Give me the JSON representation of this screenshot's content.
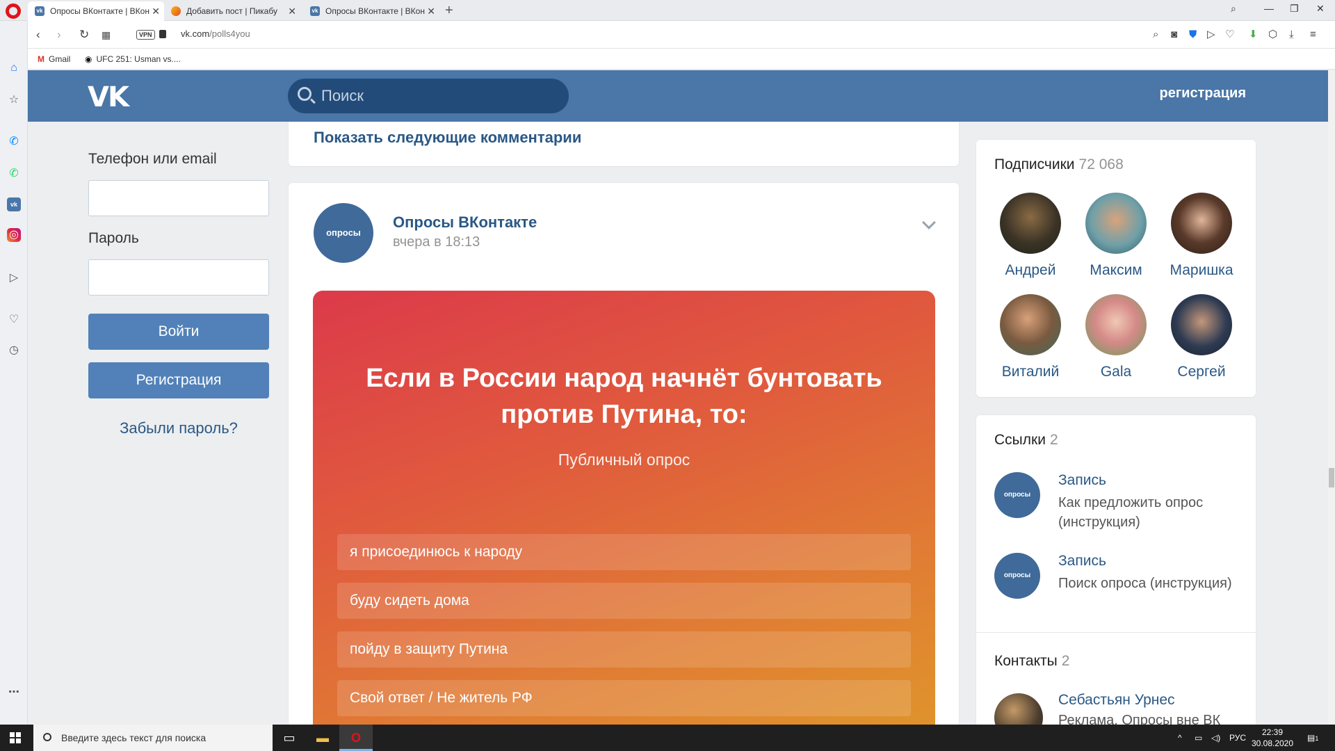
{
  "browser": {
    "tabs": [
      {
        "title": "Опросы ВКонтакте | ВКон",
        "favicon": "vk"
      },
      {
        "title": "Добавить пост | Пикабу",
        "favicon": "pikabu"
      },
      {
        "title": "Опросы ВКонтакте | ВКон",
        "favicon": "vk"
      }
    ],
    "vpn_label": "VPN",
    "url_domain": "vk.com",
    "url_path": "/polls4you",
    "bookmarks": [
      {
        "label": "Gmail",
        "icon": "M"
      },
      {
        "label": "UFC 251: Usman vs....",
        "icon": "ufc"
      }
    ]
  },
  "header": {
    "logo": "VK",
    "search_placeholder": "Поиск",
    "register_link": "регистрация"
  },
  "login": {
    "phone_label": "Телефон или email",
    "password_label": "Пароль",
    "login_button": "Войти",
    "register_button": "Регистрация",
    "forgot_link": "Забыли пароль?"
  },
  "feed": {
    "show_more": "Показать следующие комментарии",
    "post": {
      "author": "Опросы ВКонтакте",
      "time": "вчера в 18:13",
      "avatar_text": "опросы",
      "poll": {
        "question": "Если в России народ начнёт бунтовать против Путина, то:",
        "type": "Публичный опрос",
        "options": [
          "я присоединюсь к народу",
          "буду сидеть дома",
          "пойду в защиту Путина",
          "Свой ответ / Не житель РФ"
        ]
      }
    }
  },
  "sidebar": {
    "subscribers": {
      "title": "Подписчики",
      "count": "72 068",
      "members": [
        "Андрей",
        "Максим",
        "Маришка",
        "Виталий",
        "Gala",
        "Сергей"
      ]
    },
    "links": {
      "title": "Ссылки",
      "count": "2",
      "items": [
        {
          "title": "Запись",
          "desc": "Как предложить опрос (инструкция)"
        },
        {
          "title": "Запись",
          "desc": "Поиск опроса (инструкция)"
        }
      ]
    },
    "contacts": {
      "title": "Контакты",
      "count": "2",
      "items": [
        {
          "name": "Себастьян Урнес",
          "desc": "Реклама. Опросы вне ВК"
        }
      ]
    }
  },
  "taskbar": {
    "search_placeholder": "Введите здесь текст для поиска",
    "lang": "РУС",
    "time": "22:39",
    "date": "30.08.2020",
    "notifications": "1"
  },
  "colors": {
    "vk_blue": "#4a76a8",
    "link_blue": "#2a5885",
    "button_blue": "#5181b8",
    "poll_gradient_start": "#dc3a4a",
    "poll_gradient_end": "#df9a2a"
  }
}
